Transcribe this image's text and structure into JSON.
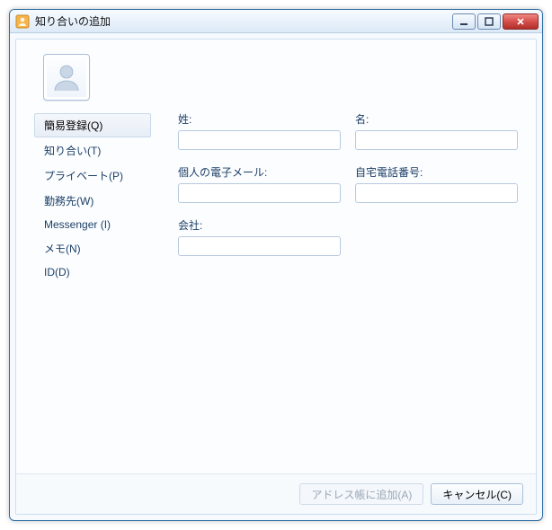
{
  "window": {
    "title": "知り合いの追加"
  },
  "sidebar": {
    "items": [
      {
        "label": "簡易登録(Q)",
        "selected": true
      },
      {
        "label": "知り合い(T)",
        "selected": false
      },
      {
        "label": "プライベート(P)",
        "selected": false
      },
      {
        "label": "勤務先(W)",
        "selected": false
      },
      {
        "label": "Messenger (I)",
        "selected": false
      },
      {
        "label": "メモ(N)",
        "selected": false
      },
      {
        "label": "ID(D)",
        "selected": false
      }
    ]
  },
  "form": {
    "last_name": {
      "label": "姓:",
      "value": ""
    },
    "first_name": {
      "label": "名:",
      "value": ""
    },
    "email": {
      "label": "個人の電子メール:",
      "value": ""
    },
    "home_phone": {
      "label": "自宅電話番号:",
      "value": ""
    },
    "company": {
      "label": "会社:",
      "value": ""
    }
  },
  "footer": {
    "add": "アドレス帳に追加(A)",
    "cancel": "キャンセル(C)"
  }
}
